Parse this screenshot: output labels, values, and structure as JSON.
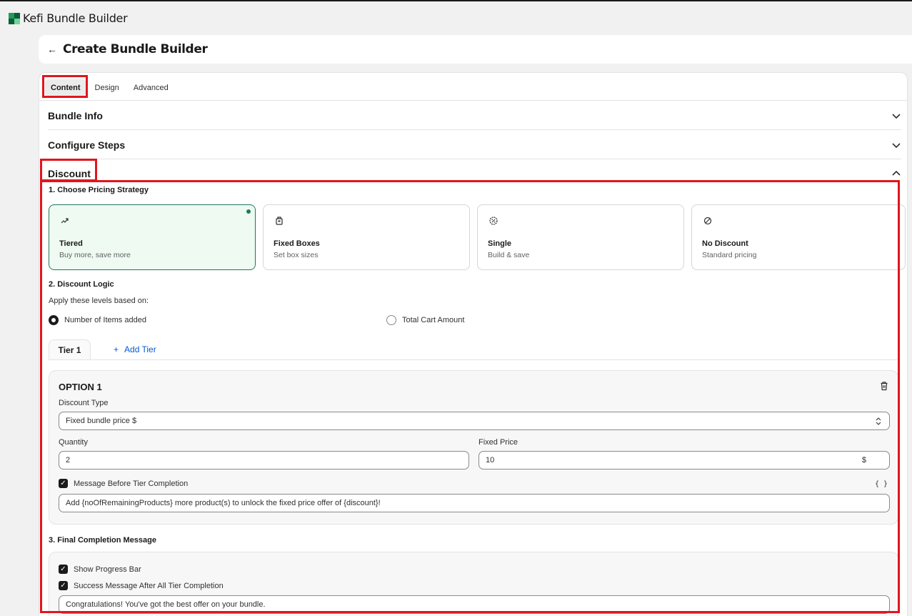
{
  "app": {
    "title": "Kefi Bundle Builder",
    "logo_icon": "kefi-logo-icon"
  },
  "header": {
    "back_icon": "arrow-left-icon",
    "title": "Create Bundle Builder"
  },
  "tabs": [
    {
      "label": "Content",
      "active": true
    },
    {
      "label": "Design",
      "active": false
    },
    {
      "label": "Advanced",
      "active": false
    }
  ],
  "sections": {
    "bundle_info": {
      "title": "Bundle Info",
      "expanded": false
    },
    "configure_steps": {
      "title": "Configure Steps",
      "expanded": false
    },
    "discount": {
      "title": "Discount",
      "expanded": true
    }
  },
  "pricing": {
    "heading": "1. Choose Pricing Strategy",
    "options": [
      {
        "name": "Tiered",
        "desc": "Buy more, save more",
        "icon": "trending-up-icon",
        "selected": true
      },
      {
        "name": "Fixed Boxes",
        "desc": "Set box sizes",
        "icon": "box-icon",
        "selected": false
      },
      {
        "name": "Single",
        "desc": "Build & save",
        "icon": "badge-percent-icon",
        "selected": false
      },
      {
        "name": "No Discount",
        "desc": "Standard pricing",
        "icon": "ban-icon",
        "selected": false
      }
    ]
  },
  "logic": {
    "heading": "2. Discount Logic",
    "apply_label": "Apply these levels based on:",
    "radio_items": "Number of Items added",
    "radio_cart": "Total Cart Amount",
    "selected": "Number of Items added"
  },
  "tiers": {
    "active_tab": "Tier 1",
    "add_label": "Add Tier"
  },
  "option": {
    "title": "OPTION 1",
    "discount_type_label": "Discount Type",
    "discount_type_value": "Fixed bundle price $",
    "quantity_label": "Quantity",
    "quantity_value": "2",
    "fixed_price_label": "Fixed Price",
    "fixed_price_value": "10",
    "fixed_price_suffix": "$",
    "message_checkbox_label": "Message Before Tier Completion",
    "message_checked": true,
    "braces": "{ }",
    "message_value": "Add {noOfRemainingProducts} more product(s) to unlock the fixed price offer of {discount}!"
  },
  "final": {
    "heading": "3. Final Completion Message",
    "progress_label": "Show Progress Bar",
    "progress_checked": true,
    "success_label": "Success Message After All Tier Completion",
    "success_checked": true,
    "success_value": "Congratulations! You've got the best offer on your bundle."
  },
  "colors": {
    "accent_green": "#1f7a5a",
    "selected_bg": "#eefaf2",
    "link_blue": "#005bd3",
    "highlight_red": "#e0161d"
  }
}
